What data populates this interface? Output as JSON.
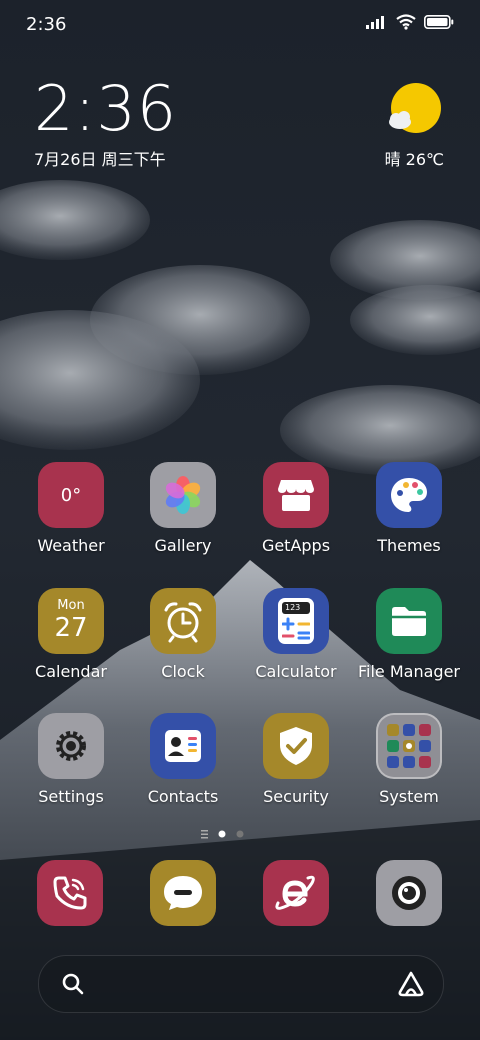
{
  "status_bar": {
    "time": "2:36"
  },
  "clock_widget": {
    "time": "2:36",
    "date": "7月26日 周三下午"
  },
  "weather_widget": {
    "text": "晴 26℃"
  },
  "apps": [
    {
      "label": "Weather",
      "color": "#a8334e",
      "icon_text": "0°",
      "icon": "weather-icon"
    },
    {
      "label": "Gallery",
      "color": "#9e9ea4",
      "icon": "gallery-flower-icon"
    },
    {
      "label": "GetApps",
      "color": "#a8334e",
      "icon": "store-icon"
    },
    {
      "label": "Themes",
      "color": "#3450a8",
      "icon": "palette-icon"
    },
    {
      "label": "Calendar",
      "color": "#a5882a",
      "icon_top": "Mon",
      "icon_text": "27",
      "icon": "calendar-icon"
    },
    {
      "label": "Clock",
      "color": "#a5882a",
      "icon": "alarm-clock-icon"
    },
    {
      "label": "Calculator",
      "color": "#3450a8",
      "icon_text": "123",
      "icon": "calculator-icon"
    },
    {
      "label": "File Manager",
      "color": "#1f8a58",
      "icon": "folder-icon"
    },
    {
      "label": "Settings",
      "color": "#9e9ea4",
      "icon": "gear-icon"
    },
    {
      "label": "Contacts",
      "color": "#3450a8",
      "icon": "contact-card-icon"
    },
    {
      "label": "Security",
      "color": "#a5882a",
      "icon": "shield-check-icon"
    },
    {
      "label": "System",
      "color": "#8f8f95",
      "icon": "folder-grid-icon"
    }
  ],
  "dock": [
    {
      "name": "phone",
      "color": "#a8334e",
      "icon": "phone-icon"
    },
    {
      "name": "messages",
      "color": "#a5882a",
      "icon": "message-bubble-icon"
    },
    {
      "name": "browser",
      "color": "#a8334e",
      "icon": "browser-e-icon"
    },
    {
      "name": "camera",
      "color": "#9e9ea4",
      "icon": "camera-icon"
    }
  ],
  "page_indicator": {
    "current": 2,
    "total": 2
  },
  "search": {
    "icon": "search-icon",
    "assistant_icon": "assistant-icon"
  }
}
